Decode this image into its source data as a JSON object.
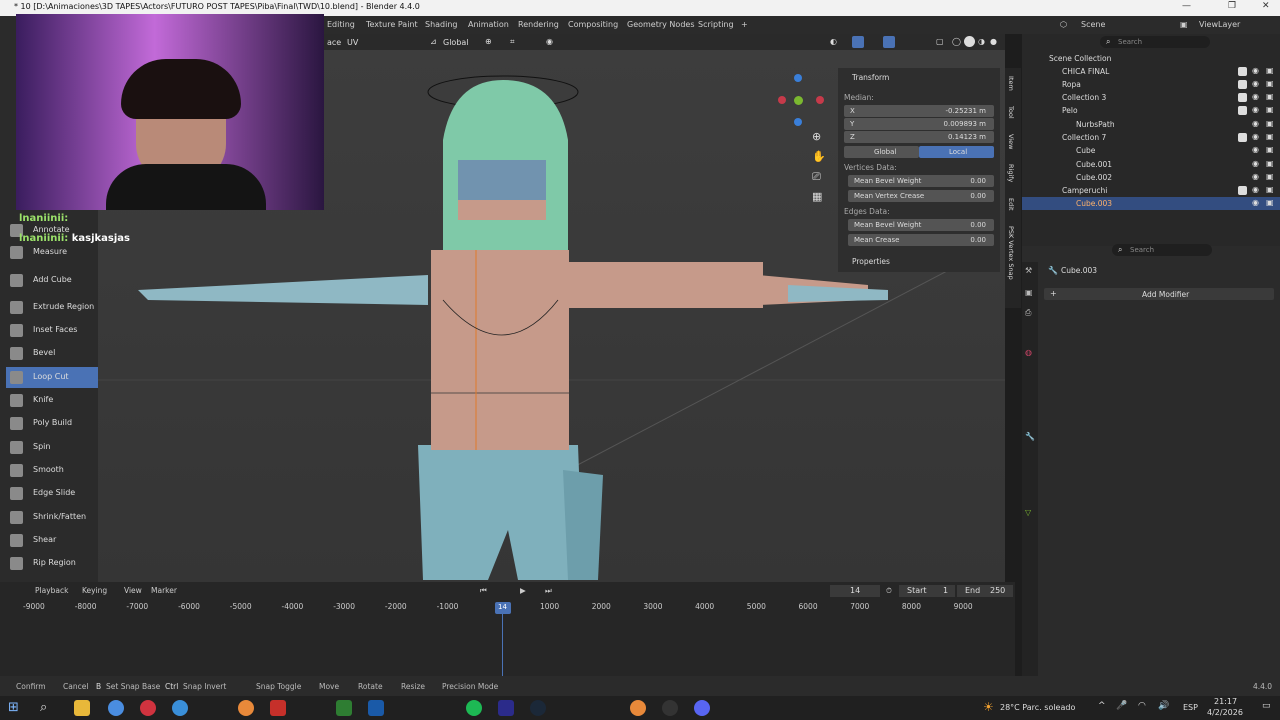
{
  "window": {
    "title": "* 10 [D:\\Animaciones\\3D TAPES\\Actors\\FUTURO POST TAPES\\Piba\\Final\\TWD\\10.blend] - Blender 4.4.0",
    "scene": "Scene",
    "view_layer": "ViewLayer"
  },
  "workspaces": [
    "Editing",
    "Texture Paint",
    "Shading",
    "Animation",
    "Rendering",
    "Compositing",
    "Geometry Nodes",
    "Scripting",
    "+"
  ],
  "viewport_header": {
    "item1": "ace",
    "item2": "UV",
    "orientation": "Global"
  },
  "chat": [
    {
      "user": "lnaniinii:",
      "text": ""
    },
    {
      "user": "lnaniinii:",
      "text": "kasjkasjas"
    }
  ],
  "tools": [
    {
      "label": "Annotate"
    },
    {
      "label": "Measure"
    },
    {
      "label": "Add Cube"
    },
    {
      "label": "Extrude Region"
    },
    {
      "label": "Inset Faces"
    },
    {
      "label": "Bevel"
    },
    {
      "label": "Loop Cut",
      "active": true
    },
    {
      "label": "Knife"
    },
    {
      "label": "Poly Build"
    },
    {
      "label": "Spin"
    },
    {
      "label": "Smooth"
    },
    {
      "label": "Edge Slide"
    },
    {
      "label": "Shrink/Fatten"
    },
    {
      "label": "Shear"
    },
    {
      "label": "Rip Region"
    }
  ],
  "npanel": {
    "section": "Transform",
    "median": "Median:",
    "x": {
      "k": "X",
      "v": "-0.25231 m"
    },
    "y": {
      "k": "Y",
      "v": "0.009893 m"
    },
    "z": {
      "k": "Z",
      "v": "0.14123 m"
    },
    "global": "Global",
    "local": "Local",
    "vertices_data": "Vertices Data:",
    "mean_bevel_v": {
      "k": "Mean Bevel Weight",
      "v": "0.00"
    },
    "mean_vertex_crease": {
      "k": "Mean Vertex Crease",
      "v": "0.00"
    },
    "edges_data": "Edges Data:",
    "mean_bevel_e": {
      "k": "Mean Bevel Weight",
      "v": "0.00"
    },
    "mean_crease": {
      "k": "Mean Crease",
      "v": "0.00"
    },
    "properties": "Properties"
  },
  "side_tabs": [
    "Item",
    "Tool",
    "View",
    "Rigify",
    "Edit",
    "PSK Vertex Snap"
  ],
  "outliner": {
    "search_placeholder": "Search",
    "rows": [
      {
        "name": "Scene Collection",
        "indent": 0
      },
      {
        "name": "CHICA FINAL",
        "indent": 1
      },
      {
        "name": "Ropa",
        "indent": 1
      },
      {
        "name": "Collection 3",
        "indent": 1
      },
      {
        "name": "Pelo",
        "indent": 1
      },
      {
        "name": "NurbsPath",
        "indent": 2
      },
      {
        "name": "Collection 7",
        "indent": 1
      },
      {
        "name": "Cube",
        "indent": 2
      },
      {
        "name": "Cube.001",
        "indent": 2
      },
      {
        "name": "Cube.002",
        "indent": 2
      },
      {
        "name": "Camperuchi",
        "indent": 1
      },
      {
        "name": "Cube.003",
        "indent": 2,
        "selected": true
      }
    ]
  },
  "properties": {
    "search_placeholder": "Search",
    "object": "Cube.003",
    "add_modifier": "Add Modifier"
  },
  "timeline": {
    "playback": "Playback",
    "keying": "Keying",
    "view": "View",
    "marker": "Marker",
    "current_frame": "14",
    "start_label": "Start",
    "start": "1",
    "end_label": "End",
    "end": "250",
    "ticks": [
      "-9000",
      "-8000",
      "-7000",
      "-6000",
      "-5000",
      "-4000",
      "-3000",
      "-2000",
      "-1000",
      "14",
      "1000",
      "2000",
      "3000",
      "4000",
      "5000",
      "6000",
      "7000",
      "8000",
      "9000"
    ]
  },
  "status": [
    "Confirm",
    "Cancel",
    "Set Snap Base",
    "Snap Invert",
    "Snap Toggle",
    "Move",
    "Rotate",
    "Resize",
    "Precision Mode"
  ],
  "status_keys": [
    "B",
    "Ctrl"
  ],
  "version": "4.4.0",
  "taskbar": {
    "weather": "28°C  Parc. soleado",
    "lang": "ESP",
    "time": "21:17",
    "date": "4/2/2026"
  }
}
